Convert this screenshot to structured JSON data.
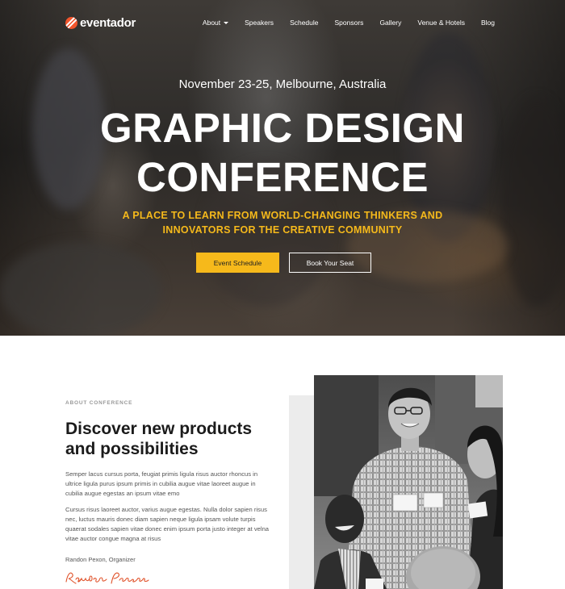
{
  "brand": {
    "name": "eventador",
    "accent": "#f2552c"
  },
  "nav": {
    "items": [
      {
        "label": "About",
        "has_dropdown": true
      },
      {
        "label": "Speakers"
      },
      {
        "label": "Schedule"
      },
      {
        "label": "Sponsors"
      },
      {
        "label": "Gallery"
      },
      {
        "label": "Venue & Hotels"
      },
      {
        "label": "Blog"
      }
    ]
  },
  "hero": {
    "date_location": "November 23-25, Melbourne, Australia",
    "title_line1": "GRAPHIC DESIGN",
    "title_line2": "CONFERENCE",
    "tagline_line1": "A PLACE TO LEARN FROM WORLD-CHANGING THINKERS AND",
    "tagline_line2": "INNOVATORS FOR THE CREATIVE COMMUNITY",
    "primary_button": "Event Schedule",
    "secondary_button": "Book Your Seat",
    "accent": "#f6b91b"
  },
  "about": {
    "eyebrow": "ABOUT CONFERENCE",
    "title_line1": "Discover new products",
    "title_line2": "and possibilities",
    "paragraph1": "Semper lacus cursus porta, feugiat primis ligula risus auctor rhoncus in ultrice ligula purus ipsum primis in cubilia augue vitae laoreet augue in cubilia augue egestas an ipsum vitae emo",
    "paragraph2": "Cursus risus laoreet auctor, varius augue egestas. Nulla dolor sapien risus nec, luctus mauris donec diam sapien neque ligula ipsam volute turpis quaerat sodales sapien vitae donec enim ipsum porta justo integer at velna vitae auctor congue magna at risus",
    "signer": "Randon Pexon, Organizer",
    "signature_text": "Randon Pexon",
    "signature_color": "#e0522a"
  }
}
